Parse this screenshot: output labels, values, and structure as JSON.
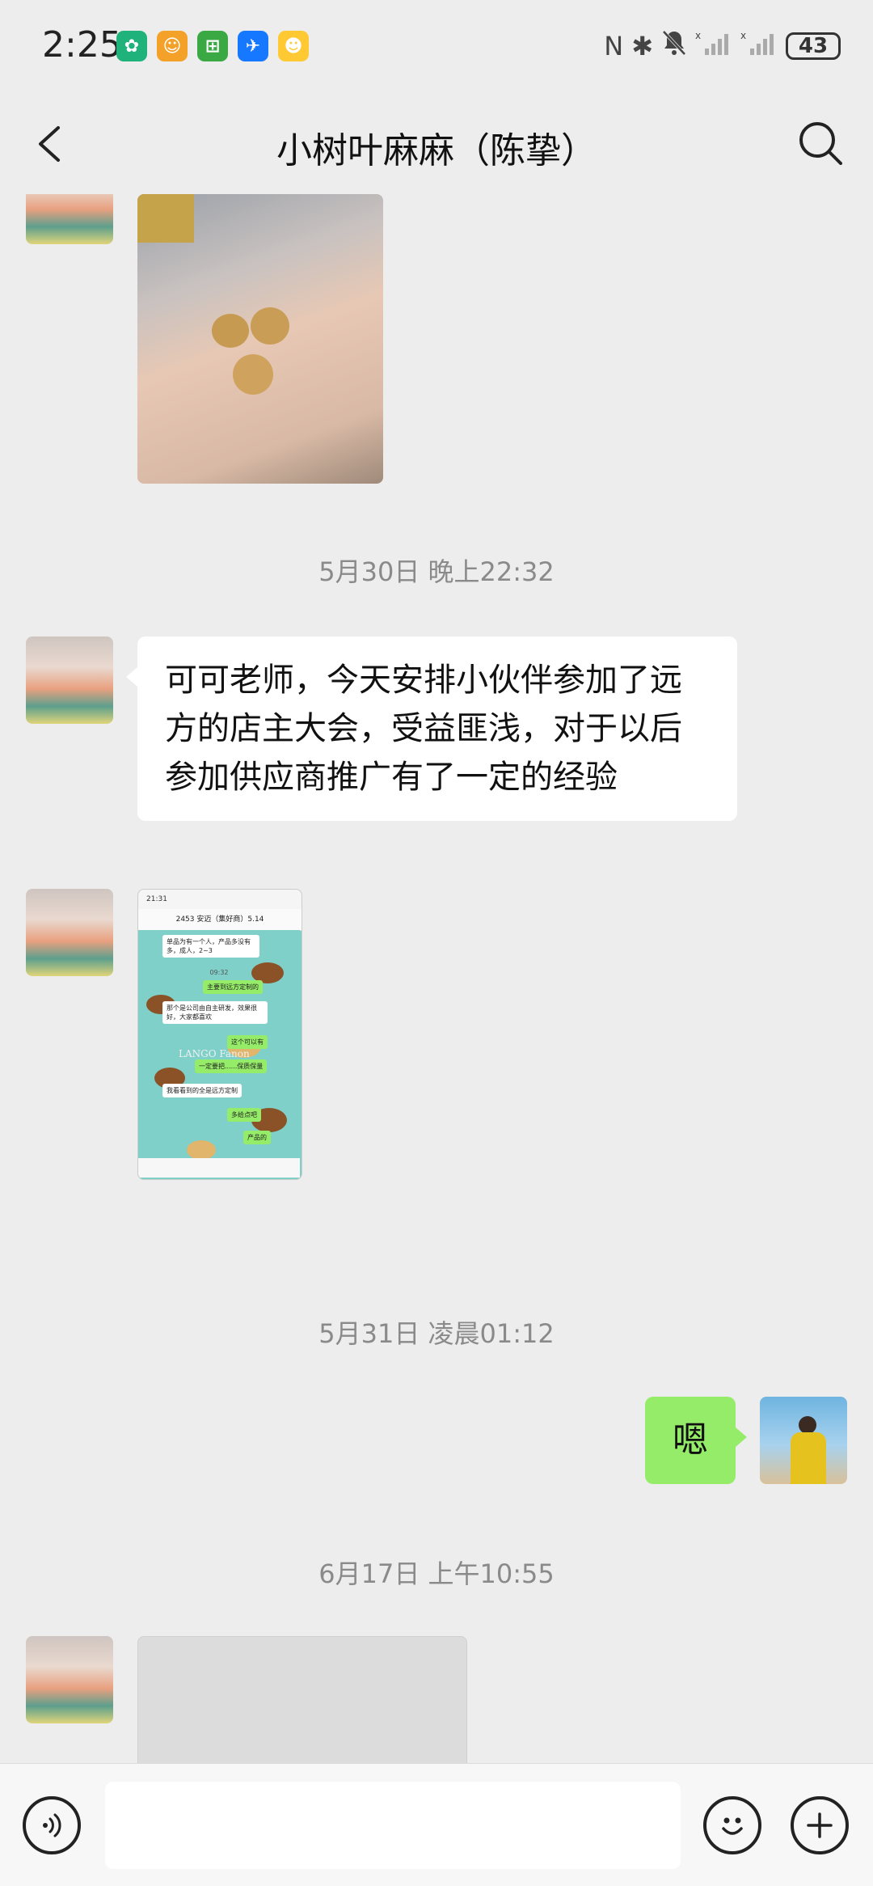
{
  "status_bar": {
    "time": "2:25",
    "app_icons": [
      {
        "icon": "clover-app-icon",
        "color": "#1fb27a"
      },
      {
        "icon": "shop-app-icon",
        "color": "#f4a12a"
      },
      {
        "icon": "meituan-app-icon",
        "color": "#3aa843"
      },
      {
        "icon": "plane-app-icon",
        "color": "#1677ff"
      },
      {
        "icon": "duck-app-icon",
        "color": "#ffc933"
      }
    ],
    "nfc_icon": "N",
    "bluetooth_icon": "✱",
    "mute_icon": "🔕",
    "signal_icon": "▂▄▆",
    "battery": "43"
  },
  "header": {
    "title": "小树叶麻麻（陈挚）"
  },
  "chat": {
    "timestamps": [
      "5月30日 晚上22:32",
      "5月31日 凌晨01:12",
      "6月17日 上午10:55"
    ],
    "messages": [
      {
        "sender": "小树叶麻麻",
        "type": "text",
        "text": "可可老师，今天安排小伙伴参加了远方的店主大会，受益匪浅，对于以后参加供应商推广有了一定的经验"
      },
      {
        "sender": "me",
        "type": "text",
        "text": "嗯"
      }
    ],
    "screenshot": {
      "status_time": "21:31",
      "title": "2453  安迈（集好商）5.14",
      "msgs": [
        "单品为有一个人，产品多没有多，成人，2~3",
        "09:32",
        "主要到远方定制的",
        "那个是公司由自主研发，效果很好，大家都喜欢",
        "这个可以有",
        "一定要把......保质保量",
        "我看看到的全是远方定制",
        "多给点吧",
        "产品的"
      ],
      "watermark": "LANGO Fanon"
    }
  },
  "bottom_bar": {
    "voice_icon": "voice-icon",
    "emoji_icon": "emoji-icon",
    "plus_icon": "plus-icon",
    "input_value": ""
  },
  "colors": {
    "background": "#ededed",
    "bubble_out": "#95ec69",
    "bubble_in": "#ffffff",
    "timestamp": "#8a8a8a"
  }
}
